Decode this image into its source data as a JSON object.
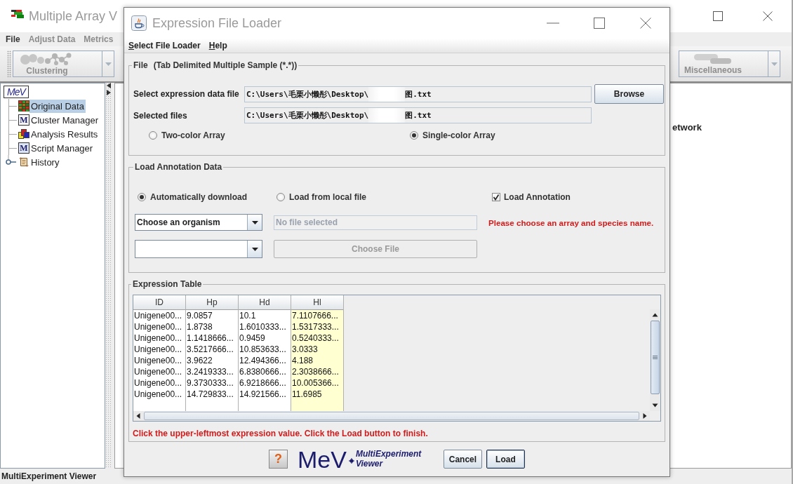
{
  "main_window": {
    "title": "Multiple Array V",
    "menu": [
      {
        "label": "File",
        "disabled": false
      },
      {
        "label": "Adjust Data",
        "disabled": true
      },
      {
        "label": "Metrics",
        "disabled": true
      }
    ],
    "toolbar": [
      {
        "label": "Clustering",
        "disabled": true
      },
      {
        "label": "Miscellaneous",
        "disabled": true
      }
    ],
    "tree": {
      "label": "MeV",
      "children": [
        {
          "label": "Original Data",
          "selected": true
        },
        {
          "label": "Cluster Manager",
          "selected": false,
          "glyph": "M"
        },
        {
          "label": "Analysis Results",
          "selected": false
        },
        {
          "label": "Script Manager",
          "selected": false,
          "glyph": "M"
        },
        {
          "label": "History",
          "selected": false,
          "expanded": false
        }
      ]
    },
    "content": {
      "text": "etwork"
    },
    "status_bar": "MultiExperiment Viewer"
  },
  "dialog": {
    "title": "Expression File Loader",
    "menu": [
      "Select File Loader",
      "Help"
    ],
    "file_section": {
      "legend": "File",
      "legend_note": "(Tab Delimited Multiple Sample (*.*))",
      "fields": [
        {
          "label": "Select expression data file",
          "value_parts": [
            "C:\\Users\\毛栗小懒彤\\Desktop\\",
            "图.txt"
          ]
        },
        {
          "label": "Selected files",
          "value_parts": [
            "C:\\Users\\毛栗小懒彤\\Desktop\\",
            "图.txt"
          ]
        }
      ],
      "browse_button": "Browse",
      "array_types": [
        {
          "label": "Two-color Array",
          "selected": false
        },
        {
          "label": "Single-color Array",
          "selected": true
        }
      ]
    },
    "annotation_section": {
      "legend": "Load Annotation Data",
      "sources": [
        {
          "label": "Automatically download",
          "selected": true
        },
        {
          "label": "Load from local file",
          "selected": false
        }
      ],
      "load_annotation": {
        "label": "Load Annotation",
        "checked": true
      },
      "organism_dropdown": {
        "value": "Choose an organism"
      },
      "file_field": {
        "placeholder": "No file selected",
        "disabled": true
      },
      "choose_file_button": {
        "label": "Choose File",
        "disabled": true
      },
      "message": "Please choose an array and species name."
    },
    "table_section": {
      "legend": "Expression Table",
      "columns": [
        {
          "label": "ID",
          "highlighted": false
        },
        {
          "label": "Hp",
          "highlighted": false
        },
        {
          "label": "Hd",
          "highlighted": false
        },
        {
          "label": "Hl",
          "highlighted": true
        }
      ],
      "rows": [
        [
          "Unigene00...",
          "9.0857",
          "10.1",
          "7.1107666..."
        ],
        [
          "Unigene00...",
          "1.8738",
          "1.6010333...",
          "1.5317333..."
        ],
        [
          "Unigene00...",
          "1.1418666...",
          "0.9459",
          "0.5240333..."
        ],
        [
          "Unigene00...",
          "3.5217666...",
          "10.853633...",
          "3.0333"
        ],
        [
          "Unigene00...",
          "3.9622",
          "12.494366...",
          "4.188"
        ],
        [
          "Unigene00...",
          "3.2419333...",
          "6.8380666...",
          "2.3038666..."
        ],
        [
          "Unigene00...",
          "9.3730333...",
          "6.9218666...",
          "10.005366..."
        ],
        [
          "Unigene00...",
          "14.729833...",
          "14.921566...",
          "11.6985"
        ]
      ],
      "hint": "Click the upper-leftmost expression value. Click the Load button to finish."
    },
    "footer": {
      "help_button": "?",
      "logo": {
        "name": "MeV",
        "subtitle": "MultiExperiment Viewer"
      },
      "buttons": [
        {
          "label": "Cancel",
          "default": false
        },
        {
          "label": "Load",
          "default": true
        }
      ]
    }
  }
}
